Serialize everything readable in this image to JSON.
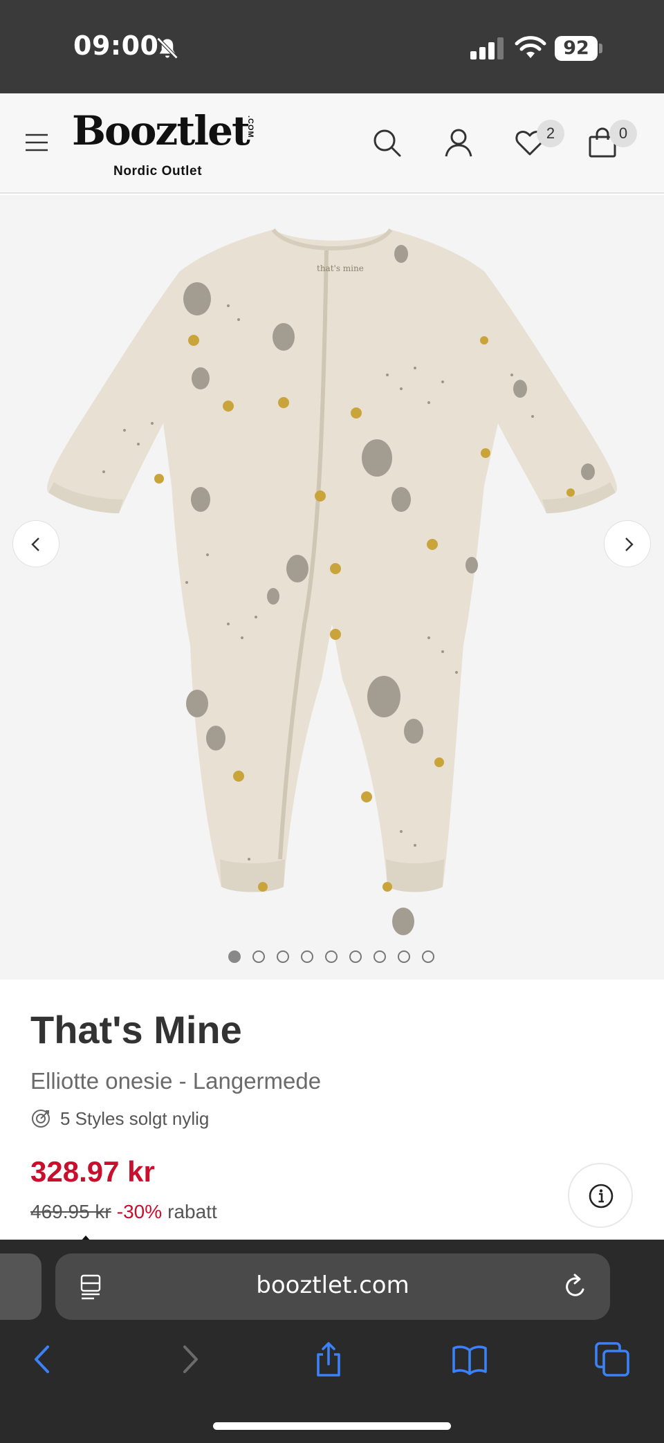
{
  "status_bar": {
    "time": "09:00",
    "battery": "92",
    "icons": [
      "bell-muted-icon",
      "signal-icon",
      "wifi-icon",
      "battery-icon"
    ]
  },
  "header": {
    "logo_text": "Booztlet",
    "logo_com": ".COM",
    "logo_subtitle": "Nordic Outlet",
    "wishlist_count": "2",
    "bag_count": "0",
    "icons": [
      "menu-icon",
      "search-icon",
      "account-icon",
      "heart-icon",
      "bag-icon"
    ]
  },
  "gallery": {
    "image_count": 9,
    "active_index": 0,
    "colors": {
      "background": "#f4f4f4",
      "garment": "#e8e1d3",
      "balloon": "#a39c91",
      "moon": "#c9a43a"
    }
  },
  "product": {
    "brand": "That's Mine",
    "name": "Elliotte onesie - Langermede",
    "sold_info": "5 Styles solgt nylig",
    "price_current": "328.97 kr",
    "price_old": "469.95 kr",
    "discount": "-30%",
    "discount_word": "rabatt",
    "colors": {
      "sale": "#c8102e",
      "text": "#333333"
    }
  },
  "browser": {
    "url": "booztlet.com",
    "icons": [
      "reader-icon",
      "reload-icon",
      "back-icon",
      "forward-icon",
      "share-icon",
      "bookmarks-icon",
      "tabs-icon"
    ]
  }
}
